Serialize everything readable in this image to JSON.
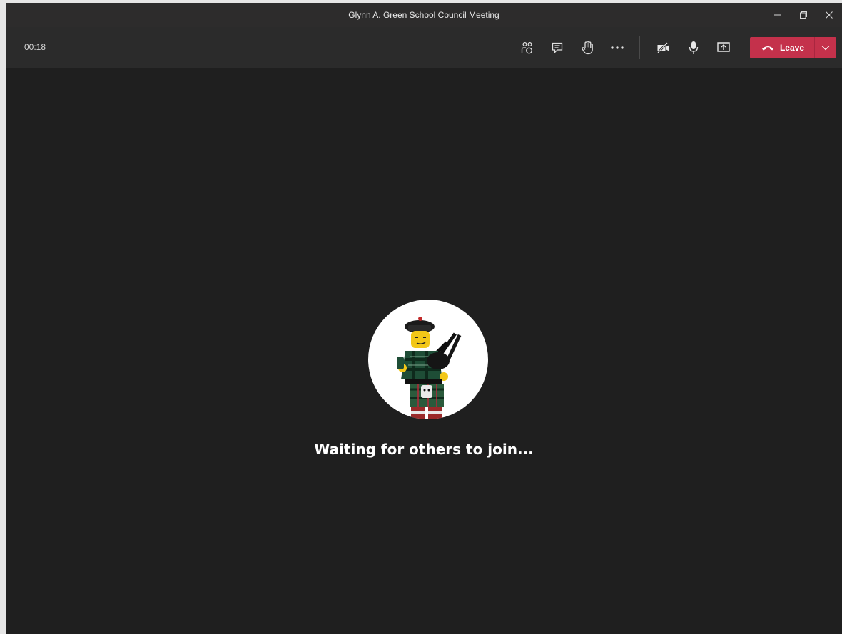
{
  "window": {
    "title": "Glynn A. Green School Council Meeting"
  },
  "toolbar": {
    "timer": "00:18",
    "leave_label": "Leave"
  },
  "icons": {
    "participants": "people-icon",
    "chat": "chat-icon",
    "raise_hand": "hand-icon",
    "more": "more-icon",
    "camera": "camera-off-icon",
    "mic": "mic-icon",
    "share": "share-screen-icon",
    "leave": "phone-hangup-icon"
  },
  "stage": {
    "status": "Waiting for others to join..."
  },
  "colors": {
    "leave": "#c4314b",
    "background": "#1f1f1f"
  }
}
